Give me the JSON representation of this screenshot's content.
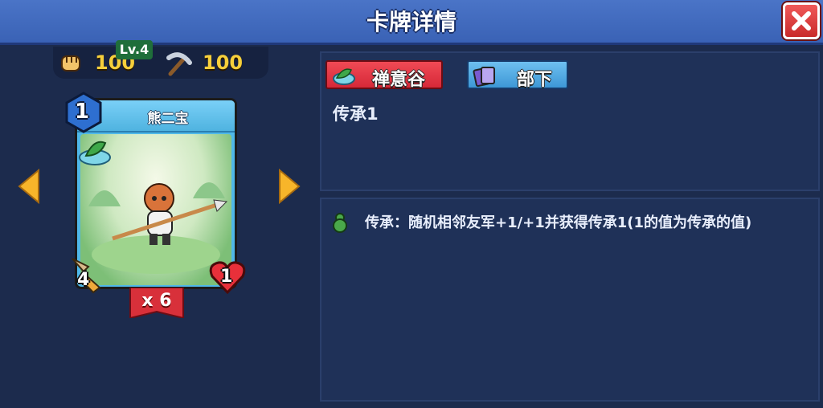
{
  "header": {
    "title": "卡牌详情",
    "close_icon": "close-icon"
  },
  "resources": {
    "fist_value": "100",
    "pickaxe_value": "100"
  },
  "card": {
    "name": "熊二宝",
    "cost": "1",
    "level": "Lv.4",
    "attack": "4",
    "health": "1",
    "count": "x 6"
  },
  "tags": {
    "faction": "禅意谷",
    "type": "部下"
  },
  "ability": {
    "title": "传承1",
    "description": "传承：随机相邻友军+1/+1并获得传承1(1的值为传承的值)"
  },
  "colors": {
    "background": "#1c2b4d",
    "title_bar": "#3a62b5",
    "resource_gold": "#f6cf3b",
    "faction_red": "#d62838",
    "type_blue": "#3d97d6"
  }
}
